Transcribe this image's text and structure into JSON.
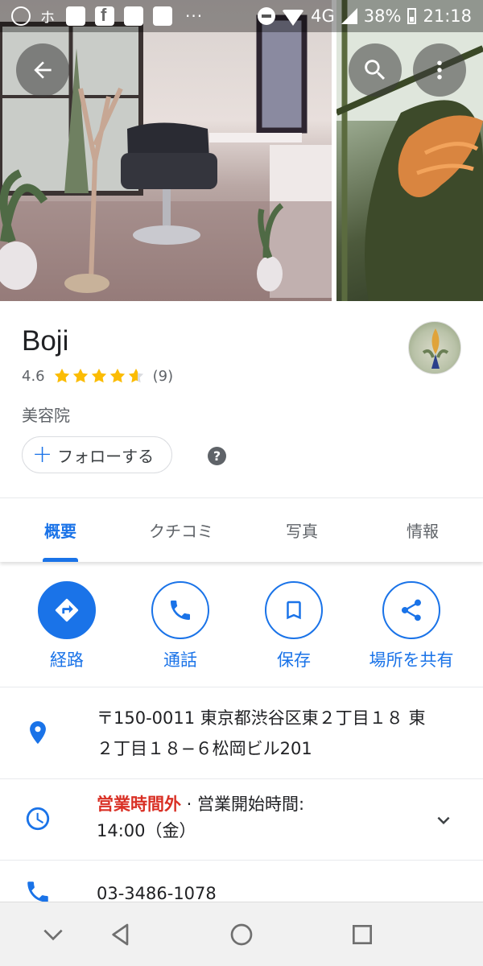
{
  "status_bar": {
    "network": "4G",
    "battery": "38%",
    "time": "21:18",
    "overflow": "···"
  },
  "place": {
    "name": "Boji",
    "rating": "4.6",
    "stars": 4.6,
    "review_count": "(9)",
    "category": "美容院",
    "follow_label": "フォローする",
    "help": "?"
  },
  "tabs": [
    {
      "label": "概要",
      "active": true
    },
    {
      "label": "クチコミ",
      "active": false
    },
    {
      "label": "写真",
      "active": false
    },
    {
      "label": "情報",
      "active": false
    }
  ],
  "actions": [
    {
      "label": "経路",
      "icon": "directions-icon"
    },
    {
      "label": "通話",
      "icon": "phone-icon"
    },
    {
      "label": "保存",
      "icon": "bookmark-icon"
    },
    {
      "label": "場所を共有",
      "icon": "share-icon"
    }
  ],
  "info": {
    "address_line1": "〒150-0011 東京都渋谷区東２丁目１８ 東",
    "address_line2": "２丁目１８−６松岡ビル201",
    "hours_status": "営業時間外",
    "hours_sep": " · ",
    "hours_text": "営業開始時間:",
    "hours_line2": "14:00（金）",
    "phone": "03-3486-1078"
  },
  "colors": {
    "accent": "#1a73e8",
    "closed": "#d93025",
    "star": "#fbbc04"
  }
}
